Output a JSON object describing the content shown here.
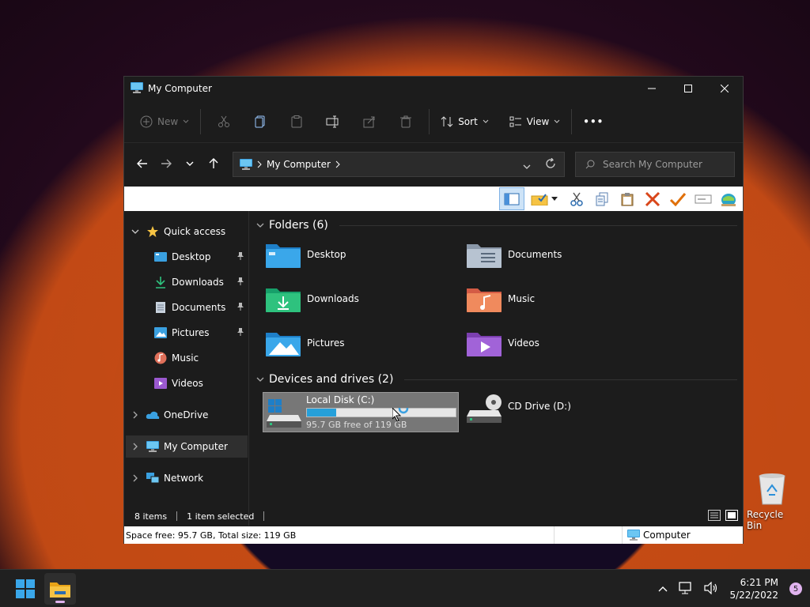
{
  "window": {
    "title": "My Computer"
  },
  "toolbar": {
    "new_label": "New",
    "sort_label": "Sort",
    "view_label": "View",
    "more_label": "•••"
  },
  "address": {
    "path": "My Computer"
  },
  "search": {
    "placeholder": "Search My Computer"
  },
  "sidebar": {
    "quick_access": "Quick access",
    "items": [
      {
        "label": "Desktop",
        "pinned": true
      },
      {
        "label": "Downloads",
        "pinned": true
      },
      {
        "label": "Documents",
        "pinned": true
      },
      {
        "label": "Pictures",
        "pinned": true
      },
      {
        "label": "Music",
        "pinned": false
      },
      {
        "label": "Videos",
        "pinned": false
      }
    ],
    "onedrive": "OneDrive",
    "my_computer": "My Computer",
    "network": "Network"
  },
  "content": {
    "folders_header": "Folders (6)",
    "folders": [
      "Desktop",
      "Documents",
      "Downloads",
      "Music",
      "Pictures",
      "Videos"
    ],
    "devices_header": "Devices and drives (2)",
    "drive_c": {
      "name": "Local Disk (C:)",
      "free_text": "95.7 GB free of 119 GB",
      "used_fraction": 0.196
    },
    "drive_d": {
      "name": "CD Drive (D:)"
    }
  },
  "status": {
    "items": "8 items",
    "selected": "1 item selected"
  },
  "classic_status": {
    "space": "Space free: 95.7 GB, Total size: 119 GB",
    "zone": "Computer"
  },
  "desktop": {
    "recycle_bin": "Recycle Bin"
  },
  "taskbar": {
    "time": "6:21 PM",
    "date": "5/22/2022",
    "notifications": "5"
  },
  "colors": {
    "accent": "#26a0da",
    "window_bg": "#1c1c1c",
    "selected_drive_bg": "#777777"
  }
}
